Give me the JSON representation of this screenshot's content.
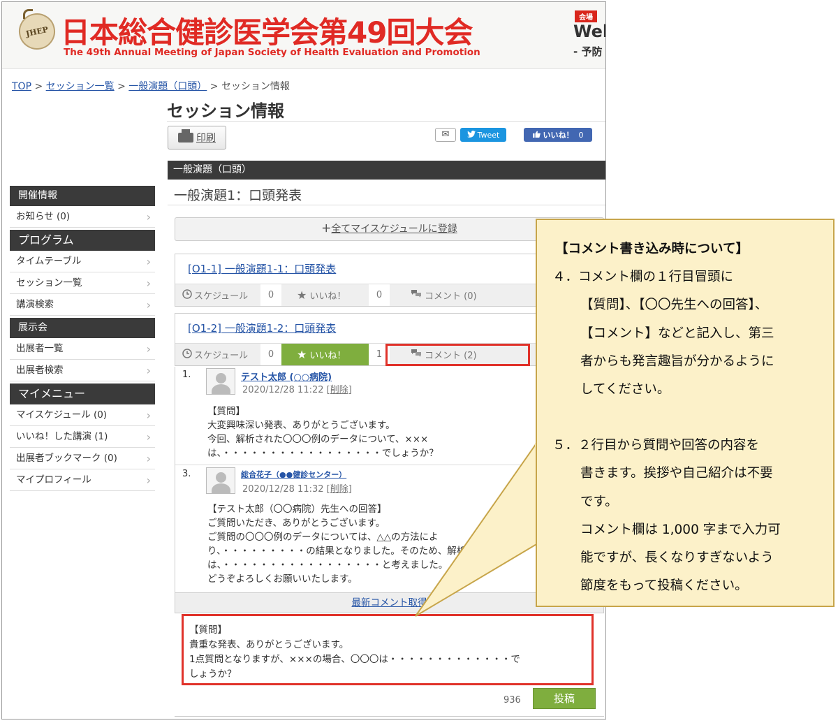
{
  "header": {
    "logo_text": "JHEP",
    "title": "日本総合健診医学会第49回大会",
    "subtitle": "The 49th Annual Meeting of Japan Society of Health Evaluation and Promotion",
    "venue_badge": "会場",
    "venue_text": "Wel",
    "venue_sub": "- 予防"
  },
  "breadcrumb": {
    "top": "TOP",
    "sep": ">",
    "sessions": "セッション一覧",
    "category": "一般演題（口頭）",
    "current": "セッション情報"
  },
  "page_title": "セッション情報",
  "toolbar": {
    "print_label": "印刷",
    "mail_icon": "✉",
    "tweet_label": "Tweet",
    "like_label": "いいね！",
    "like_count": "0"
  },
  "section_bar": "一般演題（口頭）",
  "session_name": "一般演題1：口頭発表",
  "sidebar": {
    "sections": [
      {
        "heading": "開催情報",
        "items": [
          "お知らせ (0)"
        ]
      },
      {
        "heading": "プログラム",
        "items": [
          "タイムテーブル",
          "セッション一覧",
          "講演検索"
        ]
      },
      {
        "heading": "展示会",
        "items": [
          "出展者一覧",
          "出展者検索"
        ]
      },
      {
        "heading": "マイメニュー",
        "items": [
          "マイスケジュール (0)",
          "いいね！した講演 (1)",
          "出展者ブックマーク (0)",
          "マイプロフィール"
        ]
      }
    ]
  },
  "add_all": {
    "plus": "＋",
    "label": "全てマイスケジュールに登録"
  },
  "presentations": [
    {
      "title": "[O1-1] 一般演題1-1：口頭発表",
      "schedule": "スケジュール",
      "schedule_count": "0",
      "like": "いいね！",
      "like_count": "0",
      "comment": "コメント (0)"
    },
    {
      "title": "[O1-2] 一般演題1-2：口頭発表",
      "schedule": "スケジュール",
      "schedule_count": "0",
      "like": "いいね！",
      "like_count": "1",
      "comment": "コメント (2)"
    }
  ],
  "comments": [
    {
      "num": "1.",
      "author": "テスト太郎 (○○病院)",
      "date": "2020/12/28 11:22",
      "delete": "削除",
      "body": "【質問】\n大変興味深い発表、ありがとうございます。\n今回、解析された〇〇〇例のデータについて、×××\nは、・・・・・・・・・・・・・・・・・でしょうか？"
    },
    {
      "num": "3.",
      "author": "総合花子（●●健診センター）",
      "date": "2020/12/28 11:32",
      "delete": "削除",
      "body": "【テスト太郎（〇〇病院）先生への回答】\nご質問いただき、ありがとうございます。\nご質問の〇〇〇例のデータについては、△△の方法によ\nり、・・・・・・・・・の結果となりました。そのため、解析\nは、・・・・・・・・・・・・・・・・・と考えました。\nどうぞよろしくお願いいたします。"
    }
  ],
  "latest_label": "最新コメント取得",
  "comment_input": {
    "value": "【質問】\n貴重な発表、ありがとうございます。\n1点質問となりますが、×××の場合、〇〇〇は・・・・・・・・・・・・・で\nしょうか？",
    "char_count": "936",
    "post_label": "投稿"
  },
  "callout": {
    "heading": "【コメント書き込み時について】",
    "lines": [
      {
        "text": "４．コメント欄の１行目冒頭に",
        "indent": false
      },
      {
        "text": "【質問】、【〇〇先生への回答】、",
        "indent": true
      },
      {
        "text": "【コメント】などと記入し、第三",
        "indent": true
      },
      {
        "text": "者からも発言趣旨が分かるように",
        "indent": true
      },
      {
        "text": "してください。",
        "indent": true
      },
      {
        "text": "",
        "indent": false
      },
      {
        "text": "５．２行目から質問や回答の内容を",
        "indent": false
      },
      {
        "text": "書きます。挨拶や自己紹介は不要",
        "indent": true
      },
      {
        "text": "です。",
        "indent": true
      },
      {
        "text": "コメント欄は 1,000 字まで入力可",
        "indent": true
      },
      {
        "text": "能ですが、長くなりすぎないよう",
        "indent": true
      },
      {
        "text": "節度をもって投稿ください。",
        "indent": true
      }
    ]
  },
  "colors": {
    "accent_red": "#e02a24",
    "like_green": "#7fae3e",
    "link_blue": "#2554a6",
    "callout_bg": "#fcf1c9"
  }
}
